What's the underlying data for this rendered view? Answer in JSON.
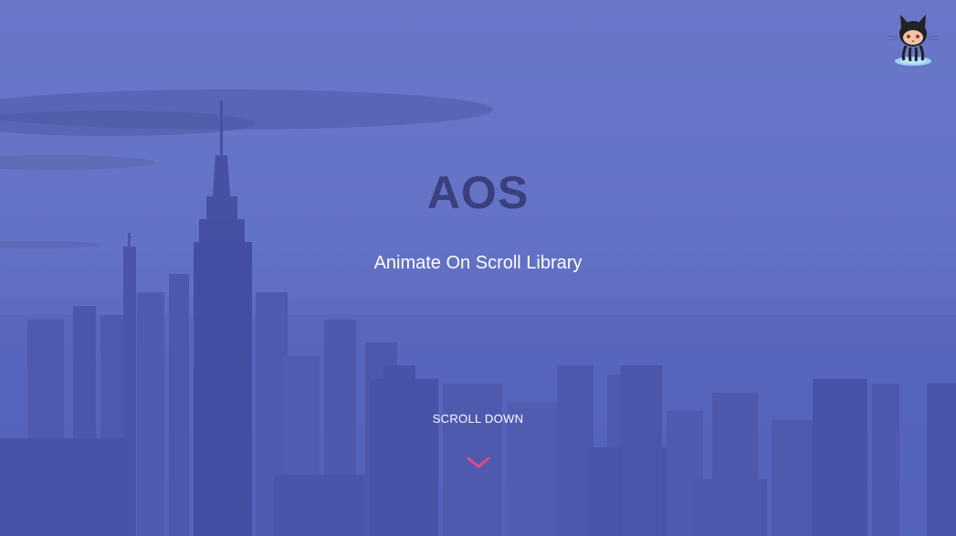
{
  "hero": {
    "title": "AOS",
    "subtitle": "Animate On Scroll Library",
    "scroll_label": "SCROLL DOWN",
    "scroll_icon": "chevron-down-icon",
    "background_image": "city-skyline-icon"
  },
  "corner_link": {
    "icon": "github-octocat-icon"
  },
  "colors": {
    "overlay": "#6470c6",
    "title": "#3a3f7d",
    "subtitle": "#ffffff",
    "chevron": "#e8458b"
  }
}
